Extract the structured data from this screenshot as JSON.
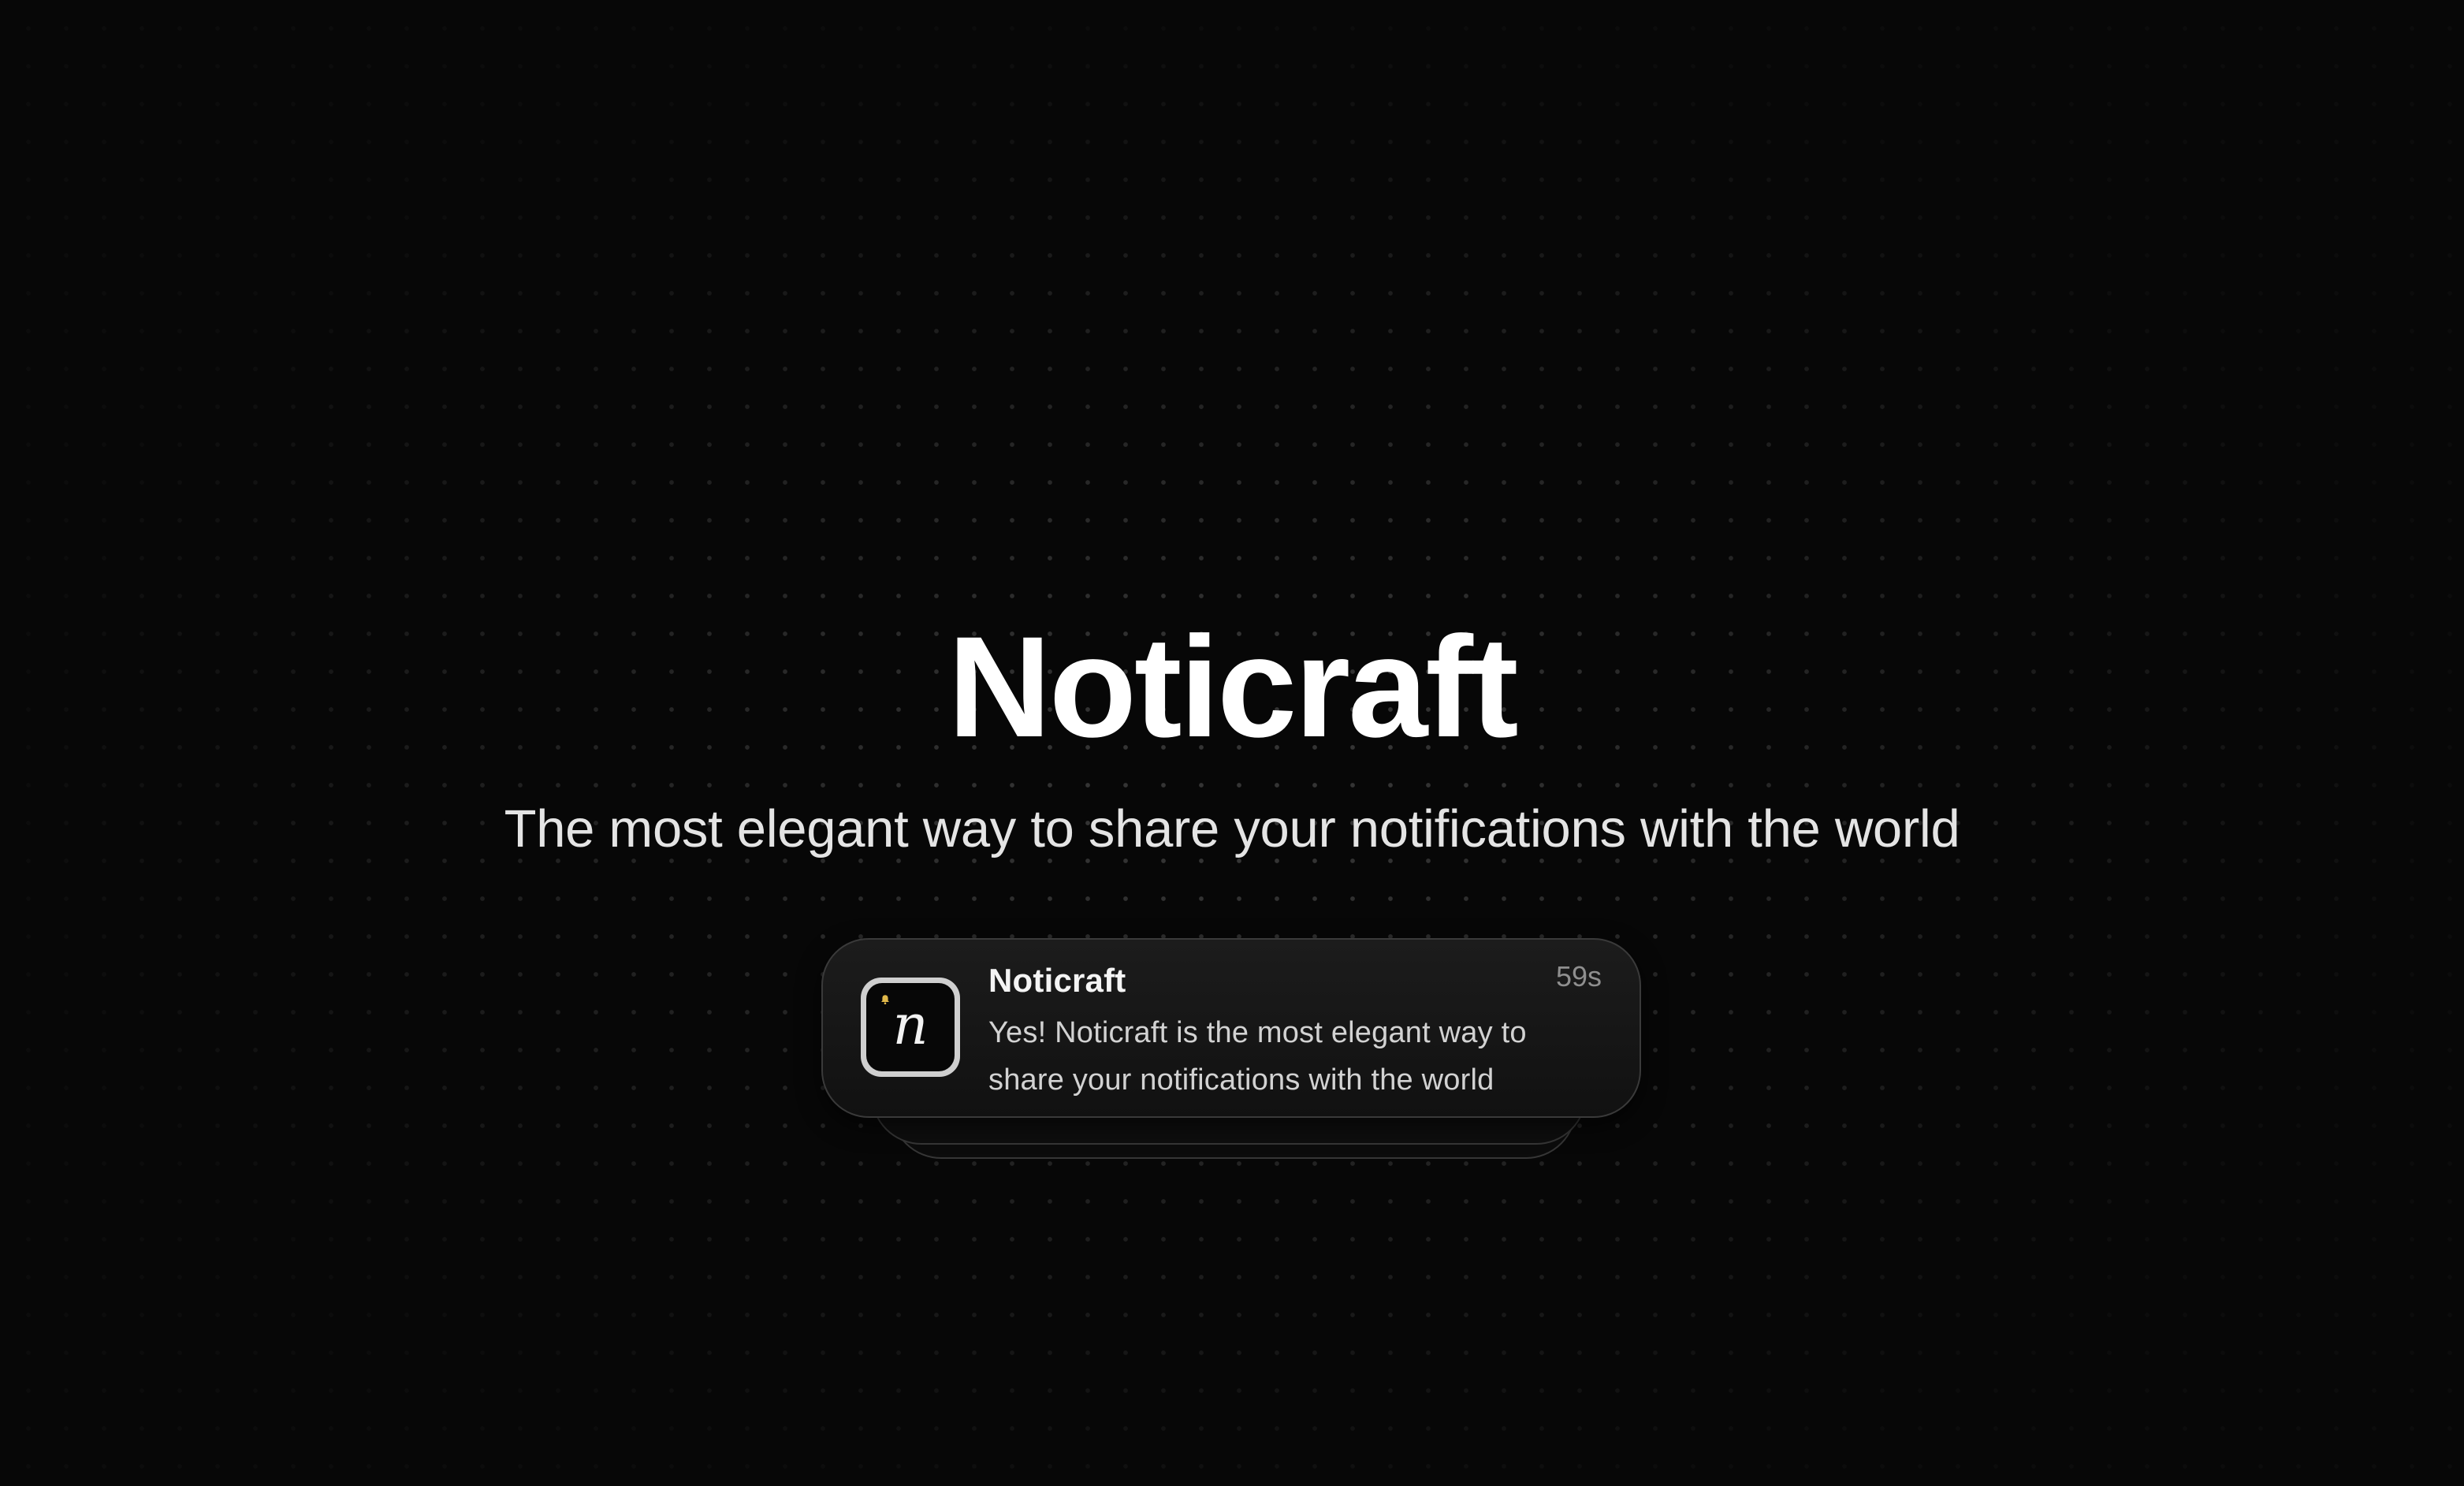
{
  "hero": {
    "title": "Noticraft",
    "subtitle": "The most elegant way to share your notifications with the world"
  },
  "notification": {
    "app_icon": {
      "letter": "n",
      "badge_icon": "bell-icon"
    },
    "title": "Noticraft",
    "time": "59s",
    "body": "Yes! Noticraft is the most elegant way to share your notifications with the world"
  },
  "colors": {
    "background": "#070707",
    "dot_grid": "#5a5a5a",
    "title_text": "#ffffff",
    "subtitle_text": "#e4e4e4",
    "card_background": "#161616",
    "card_border": "#3a3a3a",
    "time_text": "#8f8f8f",
    "bell_accent": "#e0b84a"
  }
}
